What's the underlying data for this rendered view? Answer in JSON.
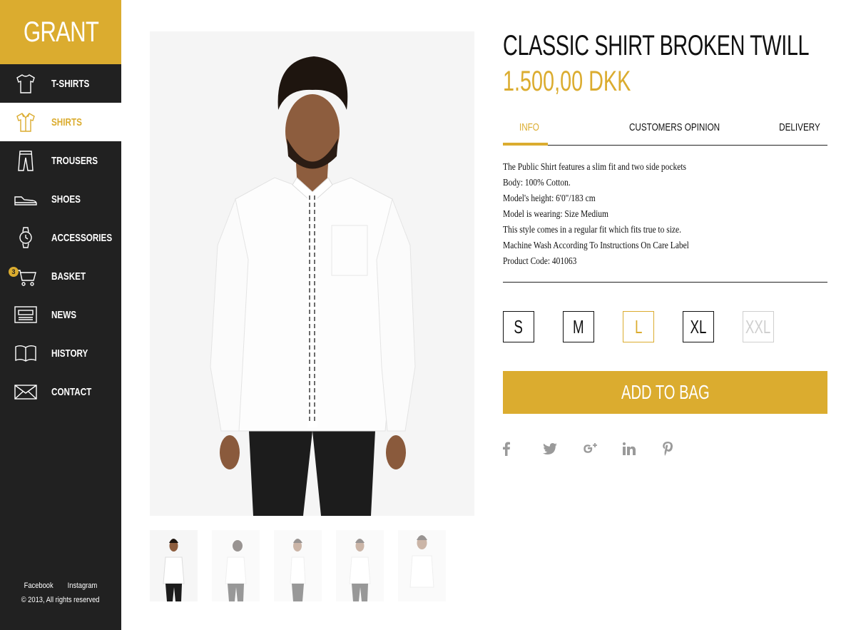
{
  "brand": {
    "name": "GRANT",
    "accent_color": "#dbac2f",
    "sidebar_bg": "#212121"
  },
  "nav": {
    "items": [
      {
        "label": "T-SHIRTS",
        "icon": "tshirt-icon",
        "active": false
      },
      {
        "label": "SHIRTS",
        "icon": "shirt-icon",
        "active": true
      },
      {
        "label": "TROUSERS",
        "icon": "trousers-icon",
        "active": false
      },
      {
        "label": "SHOES",
        "icon": "shoe-icon",
        "active": false
      },
      {
        "label": "ACCESSORIES",
        "icon": "watch-icon",
        "active": false
      },
      {
        "label": "BASKET",
        "icon": "cart-icon",
        "active": false,
        "badge": "3"
      },
      {
        "label": "NEWS",
        "icon": "newspaper-icon",
        "active": false
      },
      {
        "label": "HISTORY",
        "icon": "book-icon",
        "active": false
      },
      {
        "label": "CONTACT",
        "icon": "envelope-icon",
        "active": false
      }
    ]
  },
  "footer": {
    "facebook": "Facebook",
    "instagram": "Instagram",
    "copyright": "© 2013, All rights reserved"
  },
  "product": {
    "title": "CLASSIC SHIRT BROKEN TWILL",
    "price": "1.500,00 DKK",
    "tabs": [
      {
        "label": "INFO",
        "active": true
      },
      {
        "label": "CUSTOMERS OPINION",
        "active": false
      },
      {
        "label": "DELIVERY",
        "active": false
      }
    ],
    "info_lines": [
      "The Public Shirt features a slim fit and two side pockets",
      "Body: 100% Cotton.",
      "Model's height: 6'0\"/183 cm",
      "Model is wearing: Size Medium",
      "This style comes in a regular fit which fits true to size.",
      "Machine Wash According To Instructions On Care Label",
      "Product Code: 401063"
    ],
    "sizes": [
      {
        "label": "S",
        "state": "available"
      },
      {
        "label": "M",
        "state": "available"
      },
      {
        "label": "L",
        "state": "selected"
      },
      {
        "label": "XL",
        "state": "available"
      },
      {
        "label": "XXL",
        "state": "disabled"
      }
    ],
    "add_to_bag": "ADD TO BAG",
    "social": [
      "facebook-icon",
      "twitter-icon",
      "google-plus-icon",
      "linkedin-icon",
      "pinterest-icon"
    ],
    "thumbnails": [
      "front-view",
      "back-view",
      "side-view",
      "front-view-alt",
      "front-view-detail"
    ]
  }
}
